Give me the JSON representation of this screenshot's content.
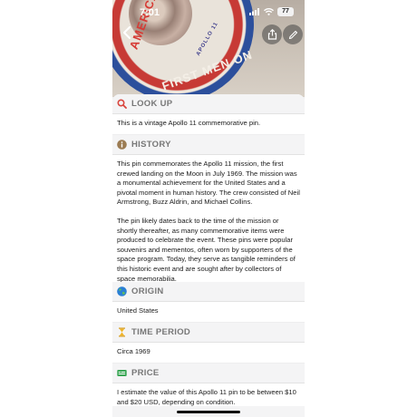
{
  "status_bar": {
    "time": "7:01",
    "battery": "77"
  },
  "hero": {
    "pin_text_left": "AMERICA S",
    "pin_text_bottom": "FIRST MEN ON",
    "pin_text_small": "APOLLO 11"
  },
  "sections": [
    {
      "icon": "magnifier-icon",
      "title": "LOOK UP",
      "paragraphs": [
        "This is a vintage Apollo 11 commemorative pin."
      ]
    },
    {
      "icon": "info-icon",
      "title": "HISTORY",
      "paragraphs": [
        "This pin commemorates the Apollo 11 mission, the first crewed landing on the Moon in July 1969. The mission was a monumental achievement for the United States and a pivotal moment in human history. The crew consisted of Neil Armstrong, Buzz Aldrin, and Michael Collins.",
        "The pin likely dates back to the time of the mission or shortly thereafter, as many commemorative items were produced to celebrate the event. These pins were popular souvenirs and mementos, often worn by supporters of the space program. Today, they serve as tangible reminders of this historic event and are sought after by collectors of space memorabilia."
      ]
    },
    {
      "icon": "globe-icon",
      "title": "ORIGIN",
      "paragraphs": [
        "United States"
      ]
    },
    {
      "icon": "hourglass-icon",
      "title": "TIME PERIOD",
      "paragraphs": [
        "Circa 1969"
      ]
    },
    {
      "icon": "banknote-icon",
      "title": "PRICE",
      "paragraphs": [
        "I estimate the value of this Apollo 11 pin to be between $10 and $20 USD, depending on condition."
      ]
    }
  ],
  "colors": {
    "lookup_icon": "#d9463e",
    "history_icon": "#9b7b52",
    "origin_icon": "#2a7fd4",
    "time_icon": "#f0b429",
    "price_icon": "#3aa655"
  }
}
